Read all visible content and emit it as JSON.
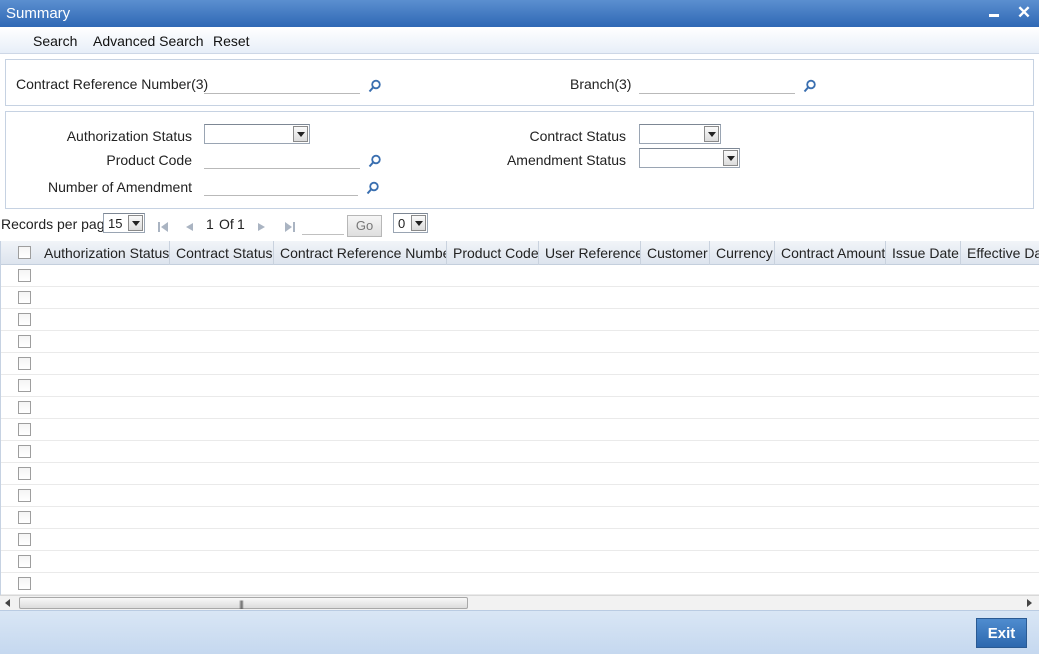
{
  "window": {
    "title": "Summary"
  },
  "menu": [
    "Search",
    "Advanced Search",
    "Reset"
  ],
  "query": {
    "contract_reference_number_label": "Contract Reference Number(3)",
    "contract_reference_number_value": "",
    "branch_label": "Branch(3)",
    "branch_value": ""
  },
  "filters": {
    "authorization_status_label": "Authorization Status",
    "authorization_status_value": "",
    "contract_status_label": "Contract Status",
    "contract_status_value": "",
    "product_code_label": "Product Code",
    "product_code_value": "",
    "amendment_status_label": "Amendment Status",
    "amendment_status_value": "",
    "number_of_amendment_label": "Number of Amendment",
    "number_of_amendment_value": ""
  },
  "pager": {
    "records_label": "Records per page",
    "records_value": "15",
    "current_page": "1",
    "of_label": "Of",
    "total_pages": "1",
    "go_label": "Go",
    "page_select_value": "0"
  },
  "grid": {
    "columns": [
      "Authorization Status",
      "Contract Status",
      "Contract Reference Number",
      "Product Code",
      "User Reference",
      "Customer",
      "Currency",
      "Contract Amount",
      "Issue Date",
      "Effective Date"
    ]
  },
  "footer": {
    "exit_label": "Exit"
  },
  "colors": {
    "title_bar": "#2f68b5",
    "exit_button": "#3a77bd",
    "lov_icon": "#3a6fb0",
    "footer": "#c9dbf0"
  },
  "icons": [
    "minimize-icon",
    "close-icon",
    "search-lov-icon",
    "first-page-icon",
    "previous-page-icon",
    "next-page-icon",
    "last-page-icon",
    "dropdown-arrow-icon"
  ]
}
